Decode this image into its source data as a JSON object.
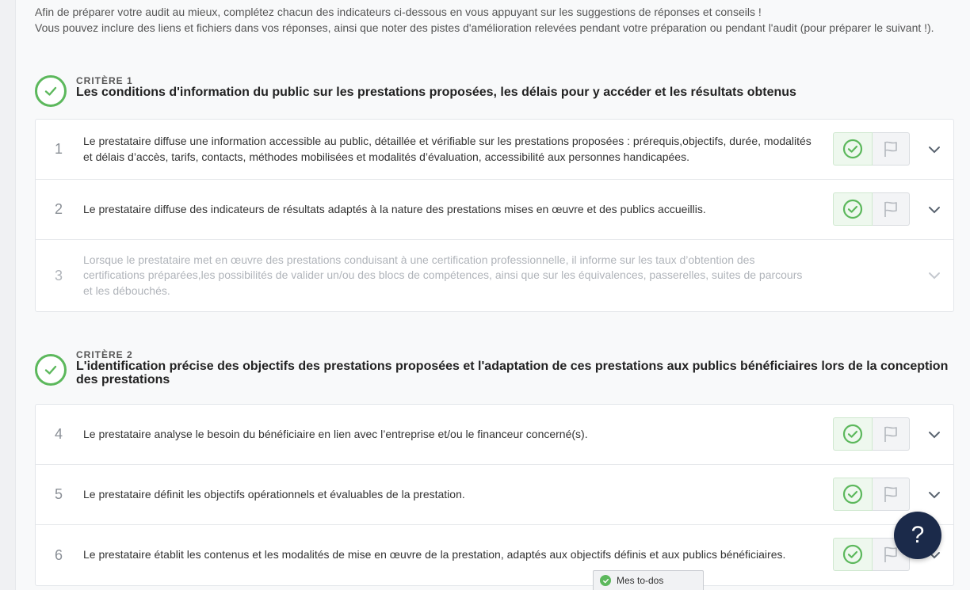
{
  "intro": {
    "line1": "Afin de préparer votre audit au mieux, complétez chacun des indicateurs ci-dessous en vous appuyant sur les suggestions de réponses et conseils !",
    "line2": "Vous pouvez inclure des liens et fichiers dans vos réponses, ainsi que noter des pistes d'amélioration relevées pendant votre préparation ou pendant l'audit (pour préparer le suivant !)."
  },
  "colors": {
    "accent": "#5cb85c",
    "help": "#1b2a4a"
  },
  "criteria": [
    {
      "label": "CRITÈRE 1",
      "title": "Les conditions d'information du public sur les prestations proposées, les délais pour y accéder et les résultats obtenus",
      "indicators": [
        {
          "num": "1",
          "text": "Le prestataire diffuse une information accessible au public, détaillée et vérifiable sur les prestations proposées : prérequis,objectifs, durée, modalités et délais d’accès, tarifs, contacts, méthodes mobilisées et modalités d’évaluation, accessibilité aux personnes handicapées."
        },
        {
          "num": "2",
          "text": "Le prestataire diffuse des indicateurs de résultats adaptés à la nature des prestations mises en œuvre et des publics accueillis."
        },
        {
          "num": "3",
          "text": "Lorsque le prestataire met en œuvre des prestations conduisant à une certification professionnelle, il informe sur les taux d’obtention des certifications préparées,les possibilités de valider un/ou des blocs de compétences, ainsi que sur les équivalences, passerelles, suites de parcours et les débouchés."
        }
      ]
    },
    {
      "label": "CRITÈRE 2",
      "title": "L'identification précise des objectifs des prestations proposées et l'adaptation de ces prestations aux publics bénéficiaires lors de la conception des prestations",
      "indicators": [
        {
          "num": "4",
          "text": "Le prestataire analyse le besoin du bénéficiaire en lien avec l’entreprise et/ou le financeur concerné(s)."
        },
        {
          "num": "5",
          "text": "Le prestataire définit les objectifs opérationnels et évaluables de la prestation."
        },
        {
          "num": "6",
          "text": "Le prestataire établit les contenus et les modalités de mise en œuvre de la prestation, adaptés aux objectifs définis et aux publics bénéficiaires."
        }
      ]
    }
  ],
  "help_button": {
    "label": "?"
  },
  "todos": {
    "label": "Mes to-dos"
  }
}
